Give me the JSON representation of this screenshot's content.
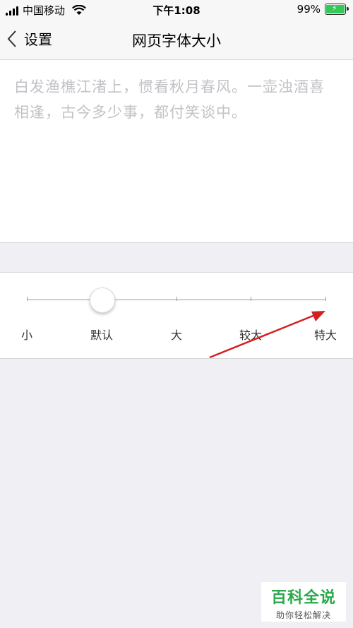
{
  "status_bar": {
    "carrier": "中国移动",
    "time": "下午1:08",
    "battery": "99%",
    "battery_level": 0.99
  },
  "nav": {
    "back_label": "设置",
    "title": "网页字体大小"
  },
  "preview": {
    "text": "白发渔樵江渚上，惯看秋月春风。一壶浊酒喜相逢，古今多少事，都付笑谈中。"
  },
  "font_size_slider": {
    "levels": [
      "小",
      "默认",
      "大",
      "较大",
      "特大"
    ],
    "selected_index": 1,
    "selected_label": "默认"
  },
  "watermark": {
    "title": "百科全说",
    "subtitle": "助你轻松解决"
  },
  "colors": {
    "annotation_arrow": "#d32020",
    "watermark_green": "#2aa84a",
    "battery_green": "#34c759"
  }
}
